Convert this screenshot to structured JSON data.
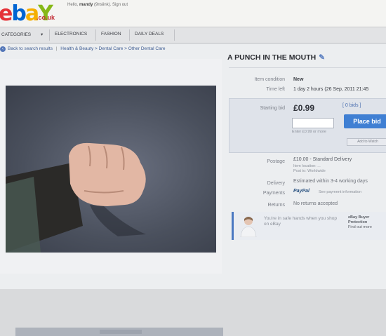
{
  "header": {
    "logo": {
      "e": "e",
      "b": "b",
      "a": "a",
      "y": "Y",
      "domain": ".co.uk"
    },
    "greeting_prefix": "Hello,",
    "username": "mandy",
    "greeting_suffix": "(9nsiink). Sign out"
  },
  "nav": {
    "items": [
      "Categories",
      "Electronics",
      "Fashion",
      "Daily deals"
    ]
  },
  "breadcrumb": {
    "back": "Back to search results",
    "path": "Health & Beauty > Dental Care > Other Dental Care"
  },
  "listing": {
    "title": "A PUNCH IN THE MOUTH",
    "condition_label": "Item condition",
    "condition": "New",
    "time_left_label": "Time left",
    "time_left": "1 day 2 hours (26 Sep, 2011 21:45",
    "starting_bid_label": "Starting bid",
    "starting_bid": "£0.99",
    "bids": "[ 0 bids ]",
    "bid_hint": "Enter £0.99 or more",
    "place_bid": "Place bid",
    "add_to_watch": "Add to Watch",
    "postage_label": "Postage",
    "postage": "£10.00 - Standard Delivery",
    "postage_sub": "Item location: ...",
    "postage_sub2": "Post to: Worldwide",
    "delivery_label": "Delivery",
    "delivery": "Estimated within 3-4 working days",
    "payments_label": "Payments",
    "payments": "PayPal",
    "payments_sub": "See payment information",
    "returns_label": "Returns",
    "returns": "No returns accepted"
  },
  "promo": {
    "text": "You're in safe hands when you shop on eBay",
    "right_title": "eBay Buyer Protection",
    "right_sub": "Find out more"
  },
  "colors": {
    "accent": "#3f7fd3",
    "brand_red": "#e53238",
    "brand_blue": "#0064d2",
    "brand_yellow": "#f5af02",
    "brand_green": "#86b817"
  }
}
